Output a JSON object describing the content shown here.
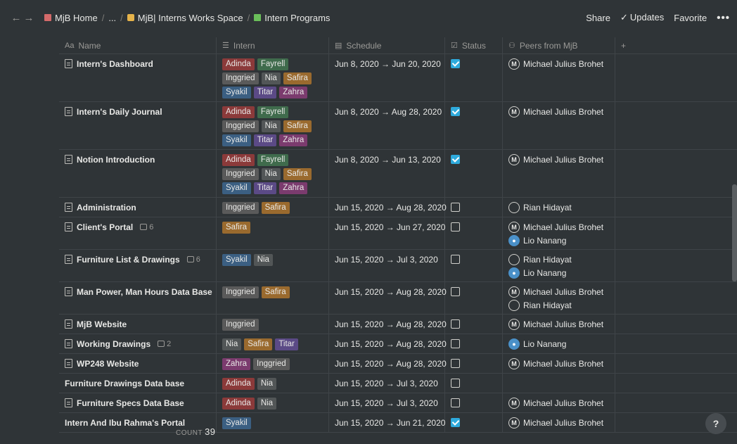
{
  "breadcrumb": {
    "items": [
      {
        "icon": "book-icon",
        "label": "MjB Home"
      },
      {
        "icon": "",
        "label": "..."
      },
      {
        "icon": "lock-icon",
        "label": "MjB| Interns Works Space"
      },
      {
        "icon": "plant-icon",
        "label": "Intern Programs"
      }
    ],
    "separator": "/"
  },
  "topbar": {
    "share_label": "Share",
    "updates_label": "Updates",
    "favorite_label": "Favorite",
    "more_label": "•••"
  },
  "table": {
    "columns": [
      {
        "key": "name",
        "label": "Name",
        "icon": "title-icon",
        "icon_glyph": "Aa"
      },
      {
        "key": "intern",
        "label": "Intern",
        "icon": "list-icon",
        "icon_glyph": "☰"
      },
      {
        "key": "schedule",
        "label": "Schedule",
        "icon": "calendar-icon",
        "icon_glyph": "▤"
      },
      {
        "key": "status",
        "label": "Status",
        "icon": "checkbox-icon",
        "icon_glyph": "☑"
      },
      {
        "key": "peers",
        "label": "Peers from MjB",
        "icon": "people-icon",
        "icon_glyph": "⚇"
      },
      {
        "key": "add",
        "label": "+",
        "icon": "",
        "icon_glyph": ""
      }
    ],
    "rows": [
      {
        "name": "Intern's Dashboard",
        "page_icon": true,
        "comments": "",
        "interns": [
          "Adinda",
          "Fayrell",
          "Inggried",
          "Nia",
          "Safira",
          "Syakil",
          "Titar",
          "Zahra"
        ],
        "schedule": "Jun 8, 2020 → Jun 20, 2020",
        "done": true,
        "peers": [
          {
            "name": "Michael Julius Brohet",
            "avatar": "M"
          }
        ]
      },
      {
        "name": "Intern's Daily Journal",
        "page_icon": true,
        "comments": "",
        "interns": [
          "Adinda",
          "Fayrell",
          "Inggried",
          "Nia",
          "Safira",
          "Syakil",
          "Titar",
          "Zahra"
        ],
        "schedule": "Jun 8, 2020 → Aug 28, 2020",
        "done": true,
        "peers": [
          {
            "name": "Michael Julius Brohet",
            "avatar": "M"
          }
        ]
      },
      {
        "name": "Notion Introduction",
        "page_icon": true,
        "comments": "",
        "interns": [
          "Adinda",
          "Fayrell",
          "Inggried",
          "Nia",
          "Safira",
          "Syakil",
          "Titar",
          "Zahra"
        ],
        "schedule": "Jun 8, 2020 → Jun 13, 2020",
        "done": true,
        "peers": [
          {
            "name": "Michael Julius Brohet",
            "avatar": "M"
          }
        ]
      },
      {
        "name": "Administration",
        "page_icon": true,
        "comments": "",
        "interns": [
          "Inggried",
          "Safira"
        ],
        "schedule": "Jun 15, 2020 → Aug 28, 2020",
        "done": false,
        "peers": [
          {
            "name": "Rian Hidayat",
            "avatar": ""
          }
        ]
      },
      {
        "name": "Client's Portal",
        "page_icon": true,
        "comments": "6",
        "interns": [
          "Safira"
        ],
        "schedule": "Jun 15, 2020 → Jun 27, 2020",
        "done": false,
        "peers": [
          {
            "name": "Michael Julius Brohet",
            "avatar": "M"
          },
          {
            "name": "Lio Nanang",
            "avatar": "photo"
          }
        ]
      },
      {
        "name": "Furniture List & Drawings",
        "page_icon": true,
        "comments": "6",
        "interns": [
          "Syakil",
          "Nia"
        ],
        "schedule": "Jun 15, 2020 → Jul 3, 2020",
        "done": false,
        "peers": [
          {
            "name": "Rian Hidayat",
            "avatar": ""
          },
          {
            "name": "Lio Nanang",
            "avatar": "photo"
          }
        ]
      },
      {
        "name": "Man Power, Man Hours Data Base",
        "page_icon": true,
        "comments": "",
        "interns": [
          "Inggried",
          "Safira"
        ],
        "schedule": "Jun 15, 2020 → Aug 28, 2020",
        "done": false,
        "peers": [
          {
            "name": "Michael Julius Brohet",
            "avatar": "M"
          },
          {
            "name": "Rian Hidayat",
            "avatar": ""
          }
        ]
      },
      {
        "name": "MjB Website",
        "page_icon": true,
        "comments": "",
        "interns": [
          "Inggried"
        ],
        "schedule": "Jun 15, 2020 → Aug 28, 2020",
        "done": false,
        "peers": [
          {
            "name": "Michael Julius Brohet",
            "avatar": "M"
          }
        ]
      },
      {
        "name": "Working Drawings",
        "page_icon": true,
        "comments": "2",
        "interns": [
          "Nia",
          "Safira",
          "Titar"
        ],
        "schedule": "Jun 15, 2020 → Aug 28, 2020",
        "done": false,
        "peers": [
          {
            "name": "Lio Nanang",
            "avatar": "photo"
          }
        ]
      },
      {
        "name": "WP248 Website",
        "page_icon": true,
        "comments": "",
        "interns": [
          "Zahra",
          "Inggried"
        ],
        "schedule": "Jun 15, 2020 → Aug 28, 2020",
        "done": false,
        "peers": [
          {
            "name": "Michael Julius Brohet",
            "avatar": "M"
          }
        ]
      },
      {
        "name": "Furniture Drawings Data base",
        "page_icon": false,
        "comments": "",
        "interns": [
          "Adinda",
          "Nia"
        ],
        "schedule": "Jun 15, 2020 → Jul 3, 2020",
        "done": false,
        "peers": []
      },
      {
        "name": "Furniture Specs Data Base",
        "page_icon": true,
        "comments": "",
        "interns": [
          "Adinda",
          "Nia"
        ],
        "schedule": "Jun 15, 2020 → Jul 3, 2020",
        "done": false,
        "peers": [
          {
            "name": "Michael Julius Brohet",
            "avatar": "M"
          }
        ]
      },
      {
        "name": "Intern And Ibu Rahma's Portal",
        "page_icon": false,
        "comments": "",
        "interns": [
          "Syakil"
        ],
        "schedule": "Jun 15, 2020 → Jun 21, 2020",
        "done": true,
        "peers": [
          {
            "name": "Michael Julius Brohet",
            "avatar": "M"
          }
        ]
      }
    ],
    "count_label": "COUNT",
    "count_value": "39"
  },
  "tag_colors": {
    "Adinda": "#8b3a3a",
    "Fayrell": "#3f6b4c",
    "Inggried": "#5a5a5a",
    "Nia": "#525657",
    "Safira": "#9a6a2e",
    "Syakil": "#3b5f82",
    "Titar": "#5b4a86",
    "Zahra": "#7b3b6e"
  },
  "help_label": "?"
}
